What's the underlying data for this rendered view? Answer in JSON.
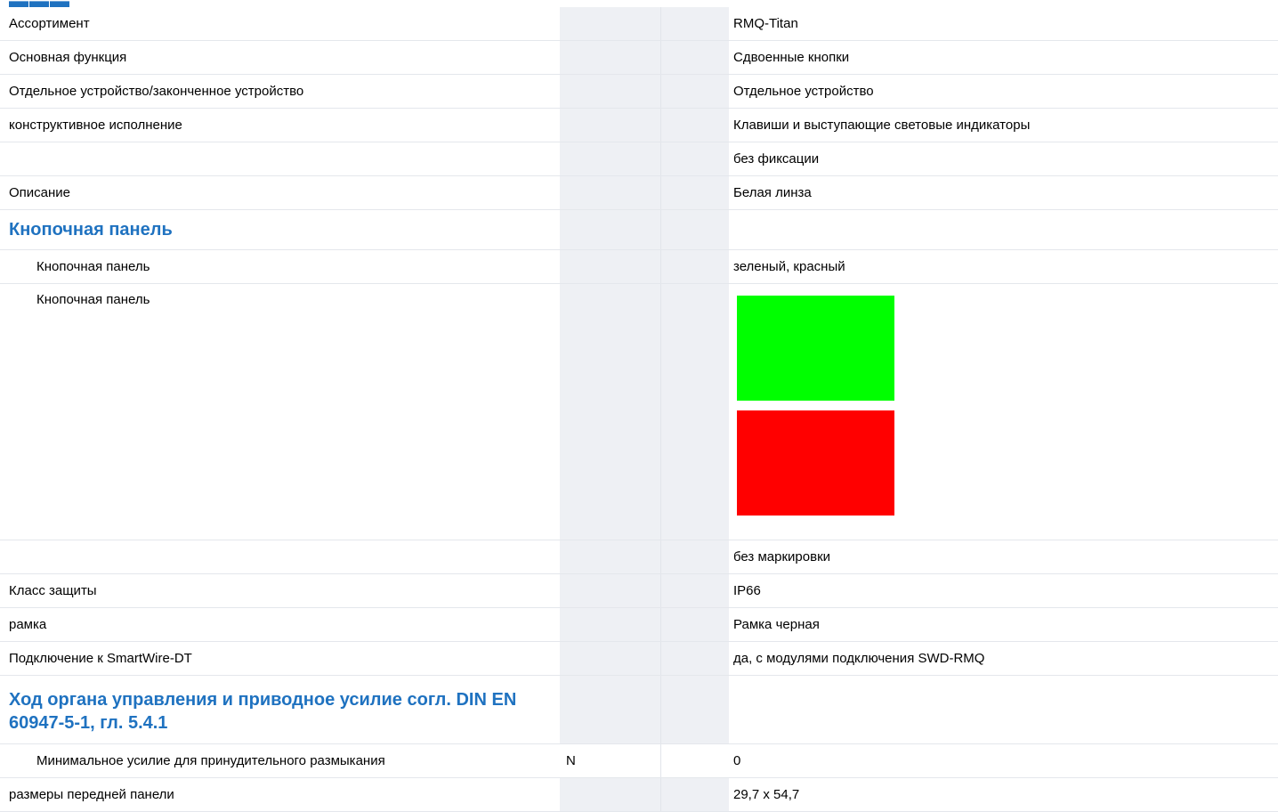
{
  "swatch_colors": [
    "#00ff00",
    "#ff0000"
  ],
  "rows": {
    "assortment": {
      "label": "Ассортимент",
      "value": "RMQ-Titan"
    },
    "main_function": {
      "label": "Основная функция",
      "value": "Сдвоенные кнопки"
    },
    "device_type": {
      "label": "Отдельное устройство/законченное устройство",
      "value": "Отдельное устройство"
    },
    "design": {
      "label": "конструктивное исполнение",
      "value": "Клавиши и выступающие световые индикаторы"
    },
    "latching": {
      "value": "без фиксации"
    },
    "description": {
      "label": "Описание",
      "value": "Белая линза"
    },
    "button_panel_section": {
      "label": "Кнопочная панель"
    },
    "button_panel_colors": {
      "label": "Кнопочная панель",
      "value": "зеленый, красный"
    },
    "button_panel_image": {
      "label": "Кнопочная панель"
    },
    "marking": {
      "value": "без маркировки"
    },
    "protection": {
      "label": "Класс защиты",
      "value": "IP66"
    },
    "frame": {
      "label": "рамка",
      "value": "Рамка черная"
    },
    "smartwire": {
      "label": "Подключение к SmartWire-DT",
      "value": "да, с модулями подключения SWD-RMQ"
    },
    "stroke_section": {
      "label": "Ход органа управления и приводное усилие согл. DIN EN 60947-5-1, гл. 5.4.1"
    },
    "min_force": {
      "label": "Минимальное усилие для принудительного размыкания",
      "unit": "N",
      "value": "0"
    },
    "front_dims": {
      "label": "размеры передней панели",
      "value": "29,7 x 54,7"
    }
  }
}
